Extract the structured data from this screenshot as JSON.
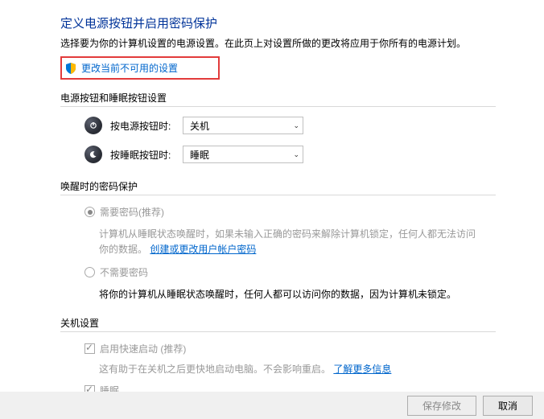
{
  "header": {
    "title": "定义电源按钮并启用密码保护",
    "description": "选择要为你的计算机设置的电源设置。在此页上对设置所做的更改将应用于你所有的电源计划。",
    "changeUnavailableLink": "更改当前不可用的设置"
  },
  "section1": {
    "heading": "电源按钮和睡眠按钮设置",
    "rows": [
      {
        "label": "按电源按钮时:",
        "value": "关机"
      },
      {
        "label": "按睡眠按钮时:",
        "value": "睡眠"
      }
    ]
  },
  "section2": {
    "heading": "唤醒时的密码保护",
    "options": [
      {
        "label": "需要密码(推荐)",
        "descPrefix": "计算机从睡眠状态唤醒时，如果未输入正确的密码来解除计算机锁定，任何人都无法访问你的数据。",
        "linkText": "创建或更改用户帐户密码",
        "checked": true
      },
      {
        "label": "不需要密码",
        "descPrefix": "将你的计算机从睡眠状态唤醒时，任何人都可以访问你的数据，因为计算机未锁定。",
        "checked": false
      }
    ]
  },
  "section3": {
    "heading": "关机设置",
    "items": [
      {
        "label": "启用快速启动 (推荐)",
        "desc": "这有助于在关机之后更快地启动电脑。不会影响重启。",
        "linkText": "了解更多信息",
        "checked": true
      },
      {
        "label": "睡眠",
        "checked": true
      }
    ]
  },
  "buttons": {
    "save": "保存修改",
    "cancel": "取消"
  }
}
